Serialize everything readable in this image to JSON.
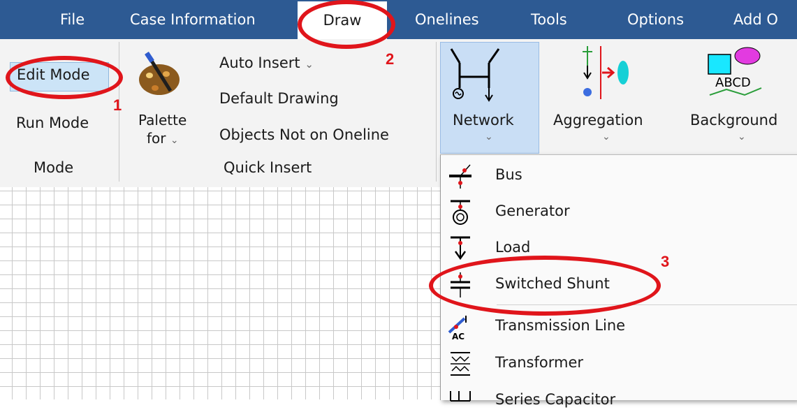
{
  "menu": {
    "items": [
      "File",
      "Case Information",
      "Draw",
      "Onelines",
      "Tools",
      "Options",
      "Add O"
    ],
    "active": "Draw"
  },
  "ribbon": {
    "mode_group": {
      "edit_mode": "Edit Mode",
      "run_mode": "Run Mode",
      "label": "Mode"
    },
    "quick_insert_group": {
      "palette_label_1": "Palette",
      "palette_label_2": "for",
      "auto_insert": "Auto Insert",
      "default_drawing": "Default Drawing",
      "objects_not_on_oneline": "Objects Not on Oneline",
      "label": "Quick Insert"
    },
    "network": "Network",
    "aggregation": "Aggregation",
    "background": "Background",
    "background_icon_text": "ABCD"
  },
  "dropdown": {
    "items": [
      "Bus",
      "Generator",
      "Load",
      "Switched Shunt",
      "Transmission Line",
      "Transformer",
      "Series Capacitor"
    ],
    "icon_text_ac": "AC"
  },
  "annotations": {
    "step1": "1",
    "step2": "2",
    "step3": "3"
  },
  "colors": {
    "menubar": "#2d5a93",
    "annotation": "#e0151b",
    "highlight": "#cce4f7"
  }
}
